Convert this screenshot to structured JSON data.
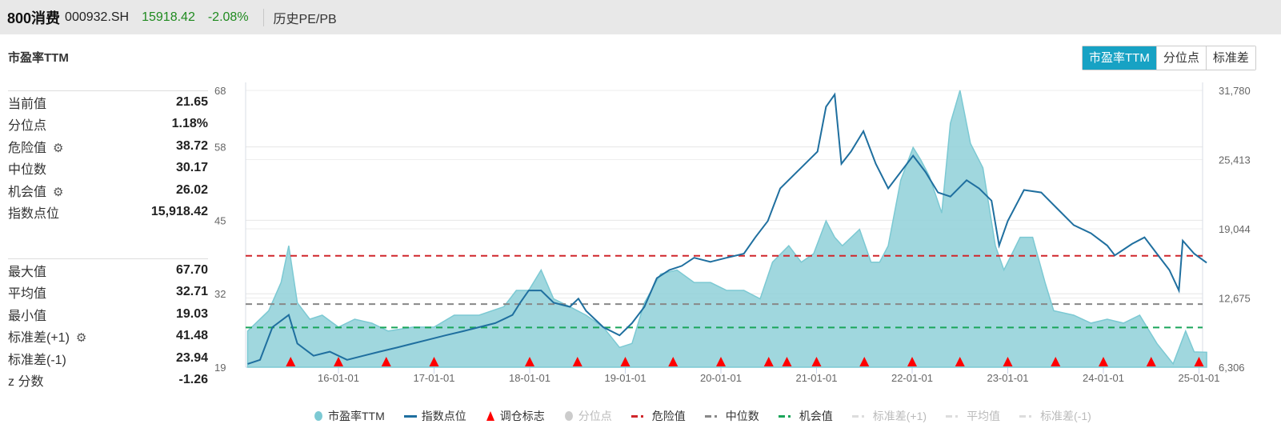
{
  "header": {
    "name": "800消费",
    "code": "000932.SH",
    "price": "15918.42",
    "change": "-2.08%",
    "section": "历史PE/PB"
  },
  "title": "市盈率TTM",
  "tabs": [
    {
      "label": "市盈率TTM",
      "active": true
    },
    {
      "label": "分位点"
    },
    {
      "label": "标准差"
    }
  ],
  "stats_top": [
    {
      "label": "当前值",
      "value": "21.65"
    },
    {
      "label": "分位点",
      "value": "1.18%"
    },
    {
      "label": "危险值",
      "value": "38.72",
      "gear": true
    },
    {
      "label": "中位数",
      "value": "30.17"
    },
    {
      "label": "机会值",
      "value": "26.02",
      "gear": true
    },
    {
      "label": "指数点位",
      "value": "15,918.42"
    }
  ],
  "stats_bottom": [
    {
      "label": "最大值",
      "value": "67.70"
    },
    {
      "label": "平均值",
      "value": "32.71"
    },
    {
      "label": "最小值",
      "value": "19.03"
    },
    {
      "label": "标准差(+1)",
      "value": "41.48",
      "gear": true
    },
    {
      "label": "标准差(-1)",
      "value": "23.94"
    },
    {
      "label": "z 分数",
      "value": "-1.26"
    }
  ],
  "colors": {
    "pe_fill": "#8fd0d8",
    "pe_line": "#7cc9d3",
    "index": "#1f6f9f",
    "danger": "#d0262b",
    "median": "#888888",
    "opportunity": "#1aa55a",
    "marker": "#ff0000"
  },
  "chart_data": {
    "type": "area",
    "x_unit": "decimal year",
    "left_axis": {
      "ticks": [
        "19",
        "32",
        "45",
        "58",
        "68"
      ],
      "range": [
        19,
        68
      ]
    },
    "right_axis": {
      "ticks": [
        "6,306",
        "12,675",
        "19,044",
        "25,413",
        "31,780"
      ],
      "range": [
        6306,
        31780
      ]
    },
    "x_ticks": [
      {
        "label": "16-01-01",
        "x": 2016
      },
      {
        "label": "17-01-01",
        "x": 2017
      },
      {
        "label": "18-01-01",
        "x": 2018
      },
      {
        "label": "19-01-01",
        "x": 2019
      },
      {
        "label": "20-01-01",
        "x": 2020
      },
      {
        "label": "21-01-01",
        "x": 2021
      },
      {
        "label": "22-01-01",
        "x": 2022
      },
      {
        "label": "23-01-01",
        "x": 2023
      },
      {
        "label": "24-01-01",
        "x": 2024
      },
      {
        "label": "25-01-01",
        "x": 2025
      }
    ],
    "x_range": [
      2014.93,
      2025.1
    ],
    "reference_lines": {
      "danger": 38.72,
      "median": 30.17,
      "opportunity": 26.02
    },
    "pe": [
      [
        2015.05,
        25.4
      ],
      [
        2015.27,
        29.0
      ],
      [
        2015.4,
        34.0
      ],
      [
        2015.48,
        40.5
      ],
      [
        2015.57,
        30.4
      ],
      [
        2015.7,
        27.5
      ],
      [
        2015.83,
        28.2
      ],
      [
        2016.0,
        26.1
      ],
      [
        2016.17,
        27.5
      ],
      [
        2016.35,
        26.8
      ],
      [
        2016.52,
        25.4
      ],
      [
        2016.78,
        26.1
      ],
      [
        2017.0,
        26.1
      ],
      [
        2017.21,
        28.2
      ],
      [
        2017.47,
        28.2
      ],
      [
        2017.73,
        29.7
      ],
      [
        2017.86,
        32.6
      ],
      [
        2017.99,
        32.6
      ],
      [
        2018.12,
        36.2
      ],
      [
        2018.25,
        31.1
      ],
      [
        2018.42,
        29.7
      ],
      [
        2018.59,
        28.2
      ],
      [
        2018.77,
        26.1
      ],
      [
        2018.94,
        22.5
      ],
      [
        2019.07,
        23.2
      ],
      [
        2019.2,
        30.4
      ],
      [
        2019.37,
        35.5
      ],
      [
        2019.54,
        36.2
      ],
      [
        2019.72,
        34.0
      ],
      [
        2019.89,
        34.0
      ],
      [
        2020.06,
        32.6
      ],
      [
        2020.24,
        32.6
      ],
      [
        2020.41,
        31.1
      ],
      [
        2020.54,
        37.6
      ],
      [
        2020.71,
        40.5
      ],
      [
        2020.84,
        37.6
      ],
      [
        2020.97,
        39.1
      ],
      [
        2021.1,
        44.9
      ],
      [
        2021.19,
        42.0
      ],
      [
        2021.27,
        40.5
      ],
      [
        2021.45,
        43.4
      ],
      [
        2021.57,
        37.6
      ],
      [
        2021.66,
        37.6
      ],
      [
        2021.75,
        40.5
      ],
      [
        2021.88,
        52.1
      ],
      [
        2022.01,
        57.9
      ],
      [
        2022.09,
        55.7
      ],
      [
        2022.18,
        52.8
      ],
      [
        2022.31,
        46.3
      ],
      [
        2022.4,
        62.2
      ],
      [
        2022.5,
        68.0
      ],
      [
        2022.61,
        58.6
      ],
      [
        2022.74,
        54.3
      ],
      [
        2022.87,
        40.5
      ],
      [
        2022.96,
        36.2
      ],
      [
        2023.13,
        42.0
      ],
      [
        2023.26,
        42.0
      ],
      [
        2023.39,
        34.0
      ],
      [
        2023.48,
        29.0
      ],
      [
        2023.69,
        28.2
      ],
      [
        2023.87,
        26.8
      ],
      [
        2024.04,
        27.5
      ],
      [
        2024.21,
        26.8
      ],
      [
        2024.38,
        28.2
      ],
      [
        2024.56,
        23.2
      ],
      [
        2024.73,
        19.6
      ],
      [
        2024.86,
        25.4
      ],
      [
        2024.95,
        21.7
      ],
      [
        2025.08,
        21.65
      ]
    ],
    "index": [
      [
        2015.05,
        6607
      ],
      [
        2015.18,
        6982
      ],
      [
        2015.31,
        9988
      ],
      [
        2015.48,
        11116
      ],
      [
        2015.57,
        8485
      ],
      [
        2015.74,
        7358
      ],
      [
        2015.91,
        7734
      ],
      [
        2016.09,
        6982
      ],
      [
        2016.26,
        7358
      ],
      [
        2016.43,
        7734
      ],
      [
        2016.61,
        8110
      ],
      [
        2016.78,
        8485
      ],
      [
        2016.95,
        8861
      ],
      [
        2017.12,
        9237
      ],
      [
        2017.3,
        9613
      ],
      [
        2017.47,
        9988
      ],
      [
        2017.64,
        10364
      ],
      [
        2017.82,
        11116
      ],
      [
        2017.9,
        12243
      ],
      [
        2017.99,
        13370
      ],
      [
        2018.12,
        13370
      ],
      [
        2018.25,
        12243
      ],
      [
        2018.42,
        11867
      ],
      [
        2018.51,
        12619
      ],
      [
        2018.59,
        11491
      ],
      [
        2018.77,
        9988
      ],
      [
        2018.94,
        9237
      ],
      [
        2019.07,
        10364
      ],
      [
        2019.2,
        11867
      ],
      [
        2019.33,
        14497
      ],
      [
        2019.46,
        15249
      ],
      [
        2019.59,
        15625
      ],
      [
        2019.72,
        16376
      ],
      [
        2019.89,
        16000
      ],
      [
        2020.06,
        16376
      ],
      [
        2020.24,
        16752
      ],
      [
        2020.36,
        18255
      ],
      [
        2020.49,
        19758
      ],
      [
        2020.62,
        22764
      ],
      [
        2020.75,
        23891
      ],
      [
        2020.88,
        25018
      ],
      [
        2021.01,
        26146
      ],
      [
        2021.1,
        30279
      ],
      [
        2021.19,
        31406
      ],
      [
        2021.26,
        25018
      ],
      [
        2021.36,
        26146
      ],
      [
        2021.49,
        28024
      ],
      [
        2021.62,
        25018
      ],
      [
        2021.75,
        22764
      ],
      [
        2021.88,
        24267
      ],
      [
        2022.01,
        25770
      ],
      [
        2022.14,
        24267
      ],
      [
        2022.27,
        22388
      ],
      [
        2022.4,
        22012
      ],
      [
        2022.57,
        23515
      ],
      [
        2022.7,
        22764
      ],
      [
        2022.83,
        21637
      ],
      [
        2022.91,
        17503
      ],
      [
        2023.0,
        19758
      ],
      [
        2023.17,
        22614
      ],
      [
        2023.35,
        22388
      ],
      [
        2023.52,
        20885
      ],
      [
        2023.69,
        19382
      ],
      [
        2023.87,
        18631
      ],
      [
        2024.04,
        17503
      ],
      [
        2024.12,
        16602
      ],
      [
        2024.3,
        17654
      ],
      [
        2024.43,
        18255
      ],
      [
        2024.56,
        16752
      ],
      [
        2024.69,
        15249
      ],
      [
        2024.79,
        13370
      ],
      [
        2024.83,
        17954
      ],
      [
        2024.95,
        16752
      ],
      [
        2025.08,
        15918
      ]
    ],
    "rebalance": [
      2015.5,
      2016.0,
      2016.5,
      2017.0,
      2018.0,
      2018.5,
      2019.0,
      2019.5,
      2020.0,
      2020.5,
      2020.69,
      2021.0,
      2021.5,
      2022.0,
      2022.5,
      2023.0,
      2023.5,
      2024.0,
      2024.5,
      2025.0
    ],
    "legend": [
      {
        "label": "市盈率TTM",
        "type": "dot",
        "color": "#7cc9d3"
      },
      {
        "label": "指数点位",
        "type": "line",
        "color": "#1f6f9f"
      },
      {
        "label": "调仓标志",
        "type": "triangle",
        "color": "#ff0000"
      },
      {
        "label": "分位点",
        "type": "dot",
        "color": "#cccccc",
        "off": true
      },
      {
        "label": "危险值",
        "type": "dash",
        "color": "#d0262b"
      },
      {
        "label": "中位数",
        "type": "dash",
        "color": "#888888"
      },
      {
        "label": "机会值",
        "type": "dash",
        "color": "#1aa55a"
      },
      {
        "label": "标准差(+1)",
        "type": "dash",
        "color": "#dddddd",
        "off": true
      },
      {
        "label": "平均值",
        "type": "dash",
        "color": "#dddddd",
        "off": true
      },
      {
        "label": "标准差(-1)",
        "type": "dash",
        "color": "#dddddd",
        "off": true
      }
    ]
  }
}
